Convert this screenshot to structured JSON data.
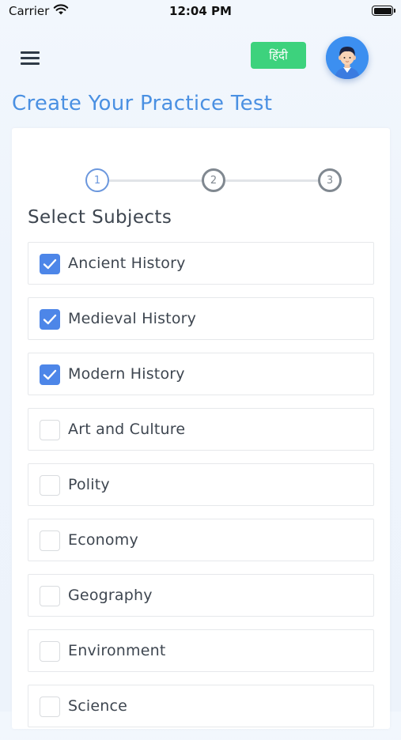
{
  "status_bar": {
    "carrier": "Carrier",
    "time": "12:04 PM"
  },
  "header": {
    "menu_icon": "hamburger-menu-icon",
    "language_button": "हिंदी",
    "avatar_icon": "user-avatar-icon",
    "accent_color": "#4a90e2",
    "language_button_color": "#3dd27d"
  },
  "page": {
    "title": "Create Your Practice Test"
  },
  "stepper": {
    "current_step": 1,
    "steps": [
      {
        "label": "1",
        "state": "active"
      },
      {
        "label": "2",
        "state": "inactive"
      },
      {
        "label": "3",
        "state": "inactive"
      }
    ]
  },
  "subjects": {
    "title": "Select Subjects",
    "items": [
      {
        "label": "Ancient History",
        "checked": true
      },
      {
        "label": "Medieval History",
        "checked": true
      },
      {
        "label": "Modern History",
        "checked": true
      },
      {
        "label": "Art and Culture",
        "checked": false
      },
      {
        "label": "Polity",
        "checked": false
      },
      {
        "label": "Economy",
        "checked": false
      },
      {
        "label": "Geography",
        "checked": false
      },
      {
        "label": "Environment",
        "checked": false
      },
      {
        "label": "Science",
        "checked": false
      }
    ],
    "checkbox_checked_color": "#4d86e8"
  }
}
